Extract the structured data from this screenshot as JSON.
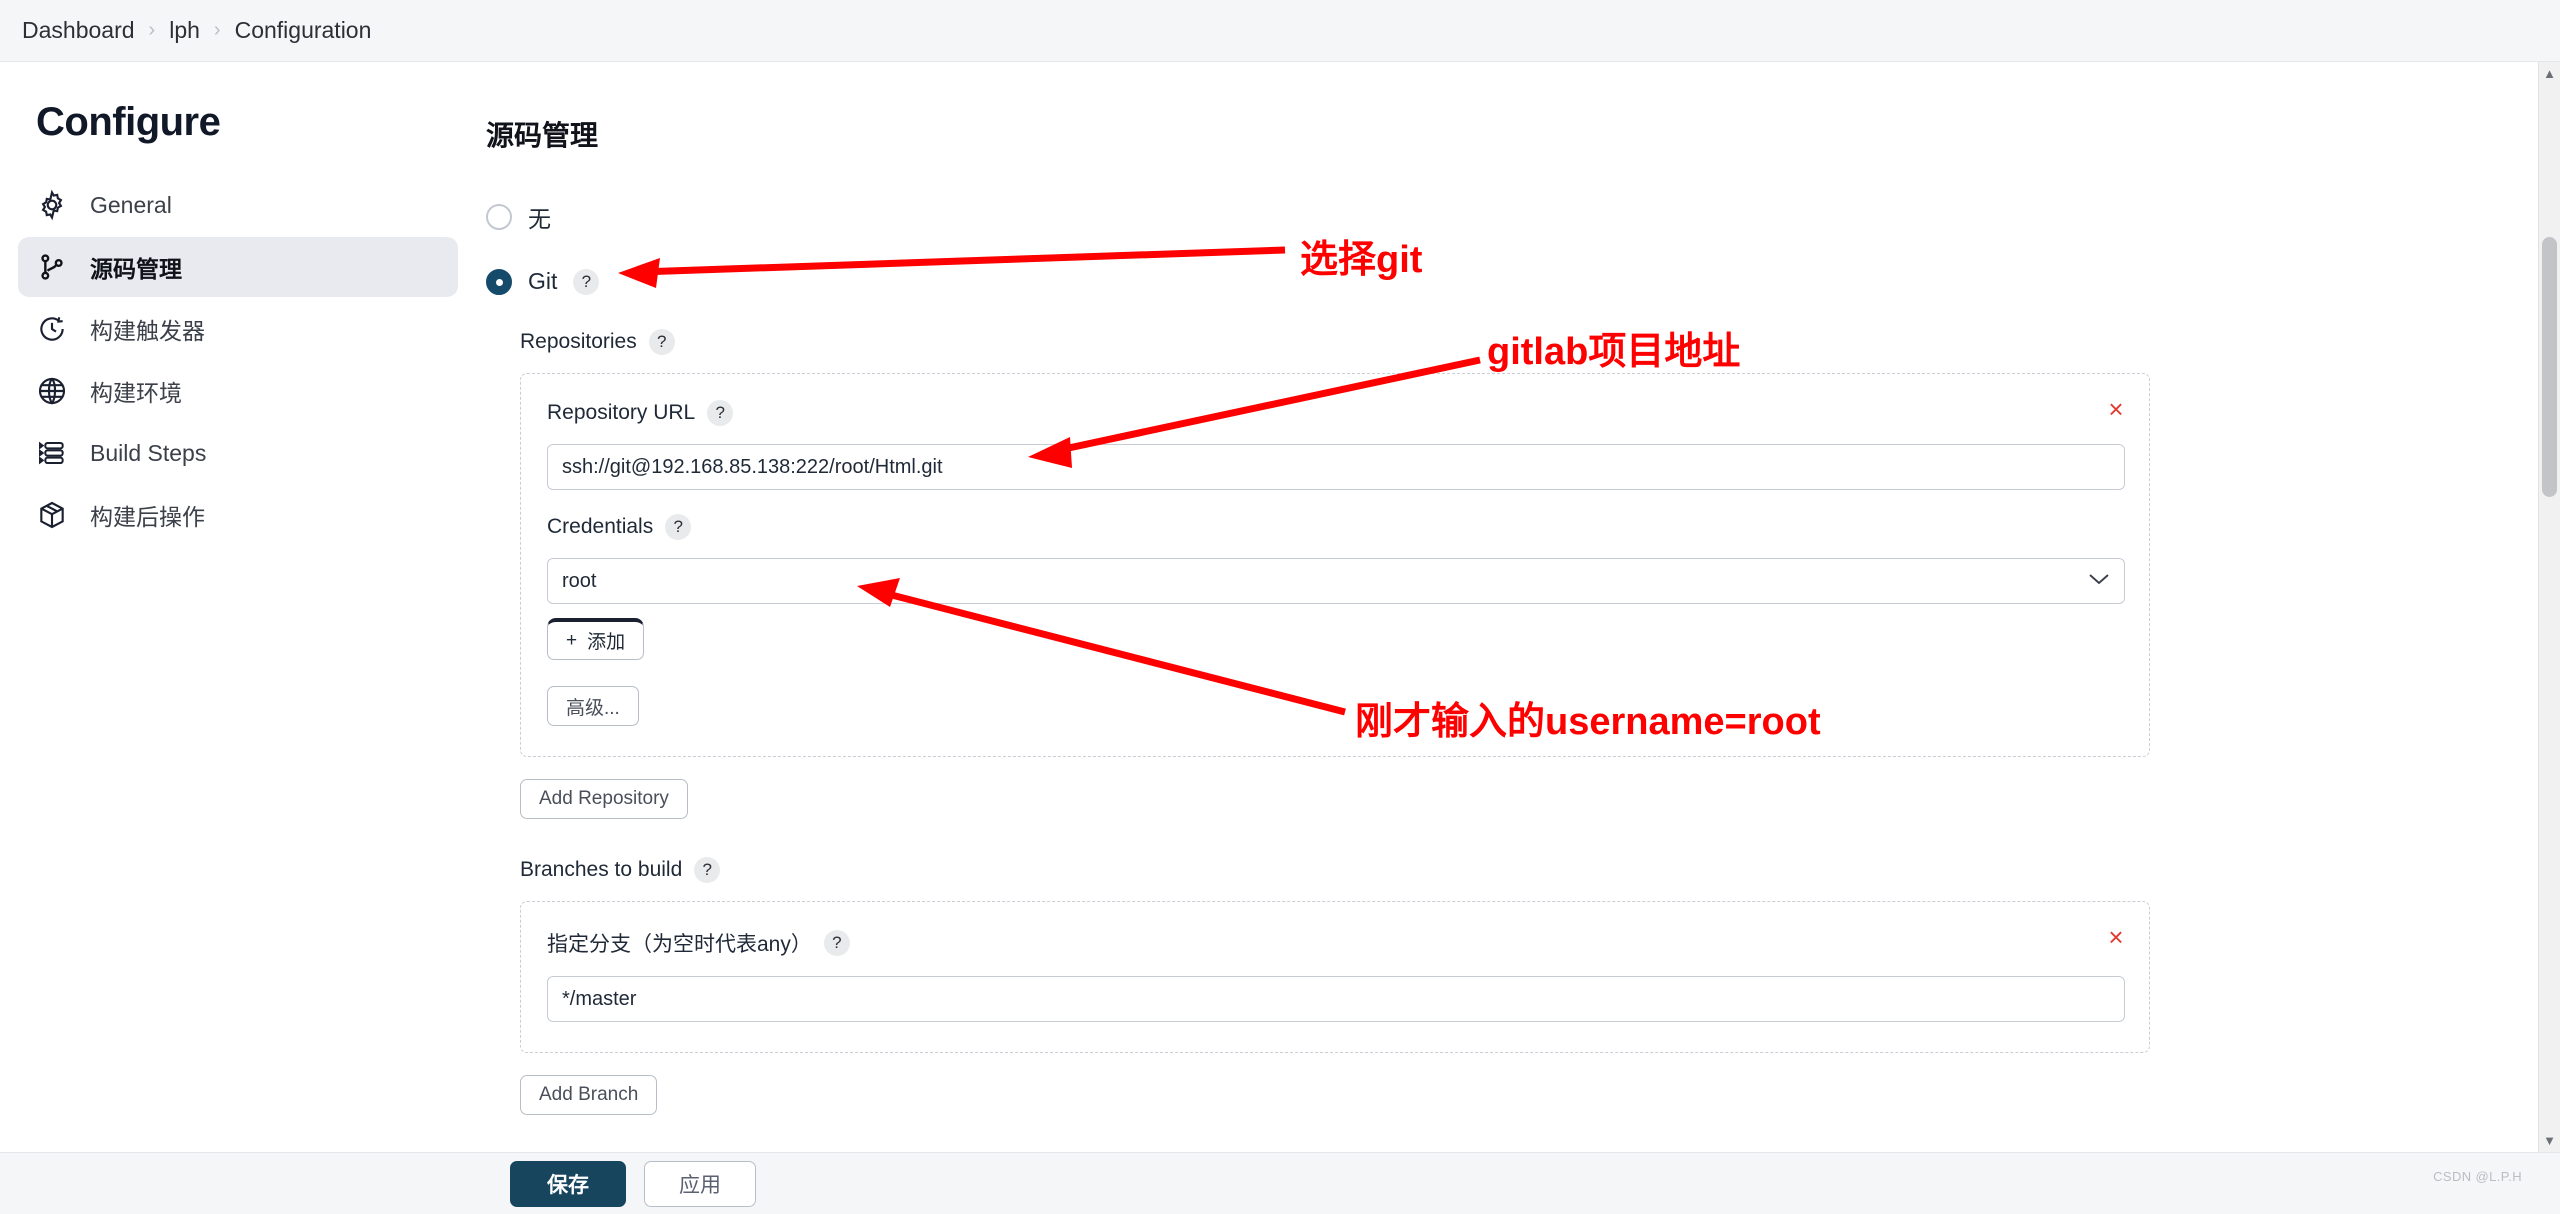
{
  "breadcrumb": {
    "items": [
      "Dashboard",
      "lph",
      "Configuration"
    ],
    "separator": "›"
  },
  "sidebar": {
    "title": "Configure",
    "items": [
      {
        "label": "General",
        "icon": "gear-icon",
        "active": false
      },
      {
        "label": "源码管理",
        "icon": "source-branch-icon",
        "active": true
      },
      {
        "label": "构建触发器",
        "icon": "clock-icon",
        "active": false
      },
      {
        "label": "构建环境",
        "icon": "globe-icon",
        "active": false
      },
      {
        "label": "Build Steps",
        "icon": "list-steps-icon",
        "active": false
      },
      {
        "label": "构建后操作",
        "icon": "package-icon",
        "active": false
      }
    ]
  },
  "main": {
    "page_title": "源码管理",
    "scm_options": [
      {
        "label": "无",
        "selected": false,
        "help": false
      },
      {
        "label": "Git",
        "selected": true,
        "help": true
      }
    ],
    "help_glyph": "?",
    "repositories": {
      "label": "Repositories",
      "repository_url": {
        "label": "Repository URL",
        "value": "ssh://git@192.168.85.138:222/root/Html.git"
      },
      "credentials": {
        "label": "Credentials",
        "value": "root",
        "chevron": "⌄"
      },
      "add_credential_button": "添加",
      "add_credential_plus": "+",
      "advanced_button": "高级...",
      "remove_glyph": "×"
    },
    "add_repository_button": "Add Repository",
    "branches": {
      "label": "Branches to build",
      "branch_specifier": {
        "label": "指定分支（为空时代表any）",
        "value": "*/master"
      },
      "remove_glyph": "×"
    },
    "add_branch_button": "Add Branch"
  },
  "footer": {
    "save_button": "保存",
    "apply_button": "应用"
  },
  "annotations": [
    {
      "text": "选择git"
    },
    {
      "text": "gitlab项目地址"
    },
    {
      "text": "刚才输入的username=root"
    }
  ],
  "watermark": "CSDN @L.P.H",
  "colors": {
    "accent": "#17455e",
    "annotation": "#fe0000",
    "sidebar_active_bg": "#e8eaef",
    "remove_red": "#e5392f"
  }
}
